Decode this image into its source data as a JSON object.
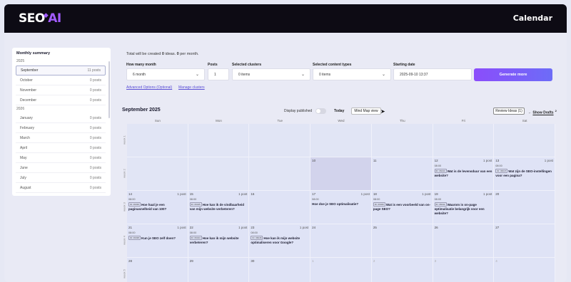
{
  "header": {
    "logo_main": "SEO",
    "logo_ai": "AI",
    "title": "Calendar"
  },
  "sidebar": {
    "title": "Monthly summary",
    "groups": [
      {
        "year": "2025",
        "months": [
          {
            "name": "September",
            "count": "11 posts",
            "active": true
          },
          {
            "name": "October",
            "count": "0 posts"
          },
          {
            "name": "November",
            "count": "0 posts"
          },
          {
            "name": "December",
            "count": "0 posts"
          }
        ]
      },
      {
        "year": "2026",
        "months": [
          {
            "name": "January",
            "count": "0 posts"
          },
          {
            "name": "February",
            "count": "0 posts"
          },
          {
            "name": "March",
            "count": "0 posts"
          },
          {
            "name": "April",
            "count": "0 posts"
          },
          {
            "name": "May",
            "count": "0 posts"
          },
          {
            "name": "June",
            "count": "0 posts"
          },
          {
            "name": "July",
            "count": "0 posts"
          },
          {
            "name": "August",
            "count": "0 posts"
          }
        ]
      }
    ]
  },
  "summary": {
    "prefix": "Total will be created",
    "ideas": "0",
    "ideas_label": "ideas.",
    "per_month": "0",
    "per_month_label": "per month."
  },
  "form": {
    "months_label": "How many month",
    "months_value": "6 month",
    "posts_label": "Posts",
    "posts_value": "1",
    "clusters_label": "Selected clusters",
    "clusters_value": "0 items",
    "content_label": "Selected content types",
    "content_value": "0 items",
    "date_label": "Starting date",
    "date_value": "2025-09-10 13:37",
    "generate": "Generate more",
    "advanced": "Advanced Options (Optional)",
    "manage": "Manage clusters"
  },
  "calendar": {
    "month": "September 2025",
    "display_published": "Display published",
    "today": "Today",
    "mind_map": "Mind Map view",
    "review": "Review Ideas (1)",
    "arrow": "←",
    "show_drafts": "Show Drafts",
    "drafts_count": "2",
    "dow": [
      "Sun",
      "Mon",
      "Tue",
      "Wed",
      "Thu",
      "Fri",
      "Sat"
    ],
    "weeks": [
      {
        "label": "week 1",
        "cells": [
          {
            "type": "empty"
          },
          {
            "type": "empty"
          },
          {
            "type": "empty"
          },
          {
            "type": "empty"
          },
          {
            "type": "empty"
          },
          {
            "type": "empty"
          },
          {
            "type": "empty"
          }
        ]
      },
      {
        "label": "week 2",
        "cells": [
          {
            "type": "empty"
          },
          {
            "type": "empty"
          },
          {
            "type": "empty"
          },
          {
            "day": "10",
            "hl": true
          },
          {
            "day": "11"
          },
          {
            "day": "12",
            "posts": "1 post",
            "time": "08:00",
            "id": "ID: 06043",
            "title": "Wat is de levensduur van een website?"
          },
          {
            "day": "13",
            "posts": "1 post",
            "time": "08:00",
            "id": "ID: 06047",
            "title": "Wat zijn de SEO-instellingen voor een pagina?"
          }
        ]
      },
      {
        "label": "week 3",
        "cells": [
          {
            "day": "14",
            "posts": "1 post",
            "time": "08:00",
            "id": "ID: 06039",
            "title": "Hoe haal je een paginasnelheid van 100?"
          },
          {
            "day": "15",
            "posts": "1 post",
            "time": "08:00",
            "id": "ID: 06045",
            "title": "Hoe kan ik de vindbaarheid van mijn website verbeteren?"
          },
          {
            "day": "16"
          },
          {
            "day": "17",
            "posts": "1 post",
            "time": "08:00",
            "id": "",
            "title": "Hoe doe je SEO optimalisatie?"
          },
          {
            "day": "18",
            "posts": "1 post",
            "time": "08:00",
            "id": "ID: 06040",
            "title": "Wat is een voorbeeld van on-page SEO?"
          },
          {
            "day": "19",
            "posts": "1 post",
            "time": "08:00",
            "id": "ID: 06042",
            "title": "Waarom is on-page optimalisatie belangrijk voor een website?"
          },
          {
            "day": "20"
          }
        ]
      },
      {
        "label": "week 4",
        "cells": [
          {
            "day": "21",
            "posts": "1 post",
            "time": "08:00",
            "id": "ID: 06038",
            "title": "Kun je SEO zelf doen?"
          },
          {
            "day": "22",
            "posts": "1 post",
            "time": "08:00",
            "id": "ID: 06044",
            "title": "Hoe kan ik mijn website verbeteren?"
          },
          {
            "day": "23",
            "posts": "1 post",
            "time": "08:00",
            "id": "ID: 06046",
            "title": "Hoe kan ik mijn website optimaliseren voor Google?"
          },
          {
            "day": "24"
          },
          {
            "day": "25"
          },
          {
            "day": "26"
          },
          {
            "day": "27"
          }
        ]
      },
      {
        "label": "week 5",
        "cells": [
          {
            "day": "28"
          },
          {
            "day": "29"
          },
          {
            "day": "30"
          },
          {
            "day": "1",
            "dim": true
          },
          {
            "day": "2",
            "dim": true
          },
          {
            "day": "3",
            "dim": true
          },
          {
            "day": "4",
            "dim": true
          }
        ]
      }
    ]
  }
}
